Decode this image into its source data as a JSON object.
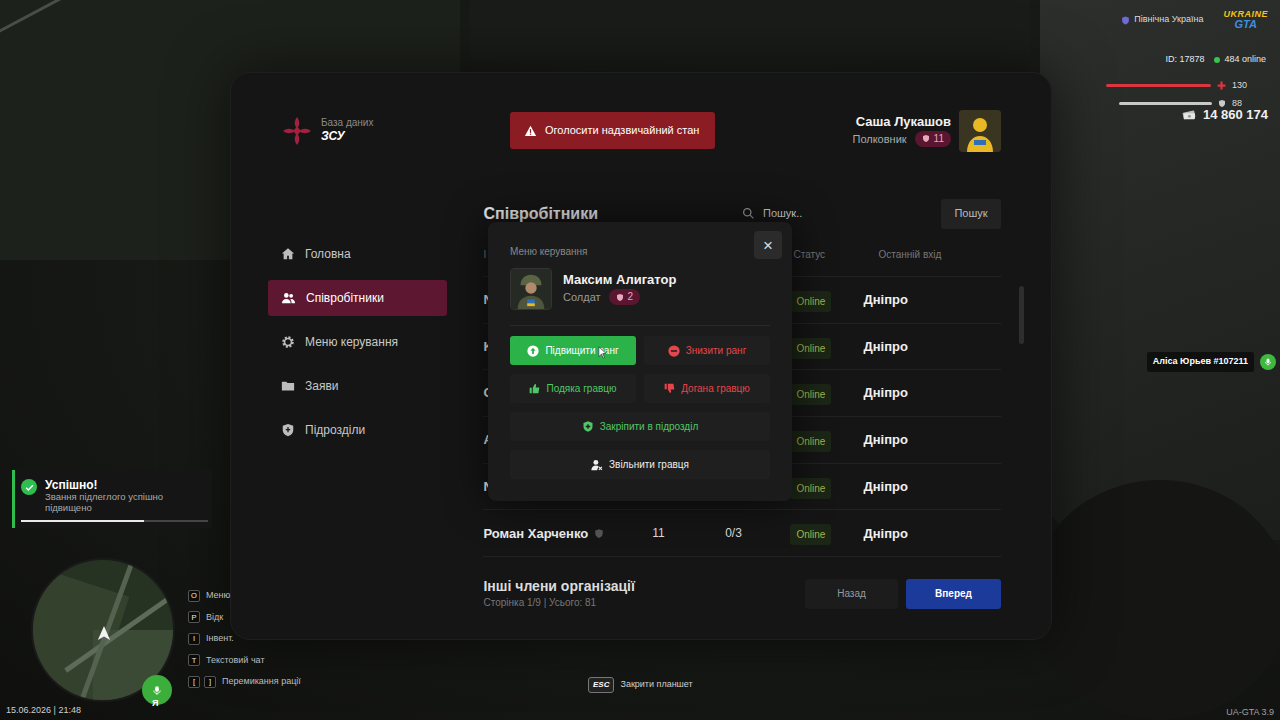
{
  "hud": {
    "region": "Північна Україна",
    "logo": {
      "top": "UKRAINE",
      "bottom": "GTA"
    },
    "player_id": "ID: 17878",
    "online": "484 online",
    "health": {
      "value": "130",
      "level": 1
    },
    "armor": {
      "value": "88",
      "level": 1
    },
    "money": "14 860 174",
    "voice": "Аліса Юрьев #107211",
    "keys": [
      {
        "keys": [
          "O"
        ],
        "label": "Меню"
      },
      {
        "keys": [
          "P"
        ],
        "label": "Відк"
      },
      {
        "keys": [
          "I"
        ],
        "label": "Інвент."
      },
      {
        "keys": [
          "T"
        ],
        "label": "Текстовий чат"
      },
      {
        "keys": [
          "[",
          "]"
        ],
        "label": "Перемикання рації"
      }
    ],
    "mic_label": "Я",
    "datetime": "15.06.2026 | 21:48",
    "close_hint": {
      "key": "ESC",
      "label": "Закрити планшет"
    },
    "version": "UA-GTA 3.9"
  },
  "notification": {
    "title": "Успішно!",
    "text": "Звання підлеглого успішно підвищено",
    "level": 0.66
  },
  "tablet": {
    "brand": {
      "subtitle": "База даних",
      "title": "ЗСУ"
    },
    "emergency_button": "Оголосити надзвичайний стан",
    "user": {
      "name": "Саша Лукашов",
      "rank": "Полковник",
      "level": "11"
    },
    "sidebar": [
      {
        "label": "Головна",
        "selected": false
      },
      {
        "label": "Співробітники",
        "selected": true
      },
      {
        "label": "Меню керування",
        "selected": false
      },
      {
        "label": "Заяви",
        "selected": false
      },
      {
        "label": "Підрозділи",
        "selected": false
      }
    ],
    "section_title": "Співробітники",
    "search": {
      "placeholder": "Пошук..",
      "button": "Пошук"
    },
    "table": {
      "columns": [
        "І",
        "Статус",
        "Останній вхід"
      ],
      "rows": [
        {
          "name": "N",
          "has_badge": false,
          "rank": "",
          "warnings": "",
          "status": "Online",
          "city": "Дніпро"
        },
        {
          "name": "K",
          "has_badge": false,
          "rank": "",
          "warnings": "",
          "status": "Online",
          "city": "Дніпро"
        },
        {
          "name": "C",
          "has_badge": false,
          "rank": "",
          "warnings": "",
          "status": "Online",
          "city": "Дніпро"
        },
        {
          "name": "A",
          "has_badge": false,
          "rank": "",
          "warnings": "",
          "status": "Online",
          "city": "Дніпро"
        },
        {
          "name": "N",
          "has_badge": false,
          "rank": "",
          "warnings": "",
          "status": "Online",
          "city": "Дніпро"
        },
        {
          "name": "Роман Харченко",
          "has_badge": true,
          "rank": "11",
          "warnings": "0/3",
          "status": "Online",
          "city": "Дніпро"
        }
      ]
    },
    "footer": {
      "title": "Інші члени організації",
      "pagination": "Сторінка 1/9 | Усього: 81",
      "prev": "Назад",
      "next": "Вперед"
    }
  },
  "modal": {
    "title": "Меню керування",
    "close": "×",
    "player": {
      "name": "Максим Алигатор",
      "rank": "Солдат",
      "level": "2"
    },
    "actions": [
      {
        "label": "Підвищити ранг",
        "kind": "promote"
      },
      {
        "label": "Знизити ранг",
        "kind": "demote"
      },
      {
        "label": "Подяка гравцю",
        "kind": "thank"
      },
      {
        "label": "Догана гравцю",
        "kind": "reprimand"
      },
      {
        "label": "Закріпити в підрозділ",
        "kind": "assign"
      },
      {
        "label": "Звільнити гравця",
        "kind": "dismiss"
      }
    ]
  }
}
